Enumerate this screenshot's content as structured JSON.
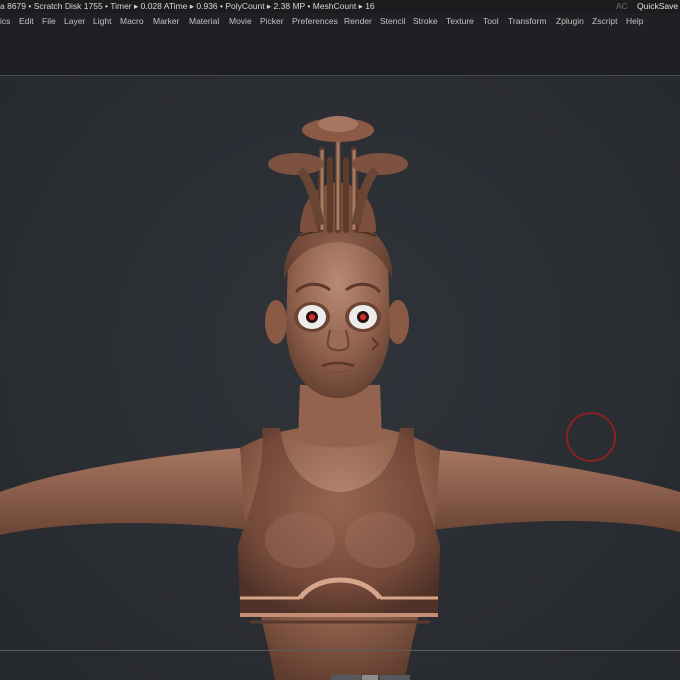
{
  "statusbar": {
    "stats": "a 8679 • Scratch Disk 1755 •  Timer ▸ 0.028 ATime ▸ 0.936 • PolyCount ▸ 2.38 MP  • MeshCount ▸ 16",
    "ac": "AC",
    "quicksave": "QuickSave"
  },
  "menu": [
    "ics",
    "Edit",
    "File",
    "Layer",
    "Light",
    "Macro",
    "Marker",
    "Material",
    "Movie",
    "Picker",
    "Preferences",
    "Render",
    "Stencil",
    "Stroke",
    "Texture",
    "Tool",
    "Transform",
    "Zplugin",
    "Zscript",
    "Help"
  ],
  "colors": {
    "clay": "#8a5a45",
    "background": "#2a2d31",
    "brush_ring": "#8b2222"
  }
}
